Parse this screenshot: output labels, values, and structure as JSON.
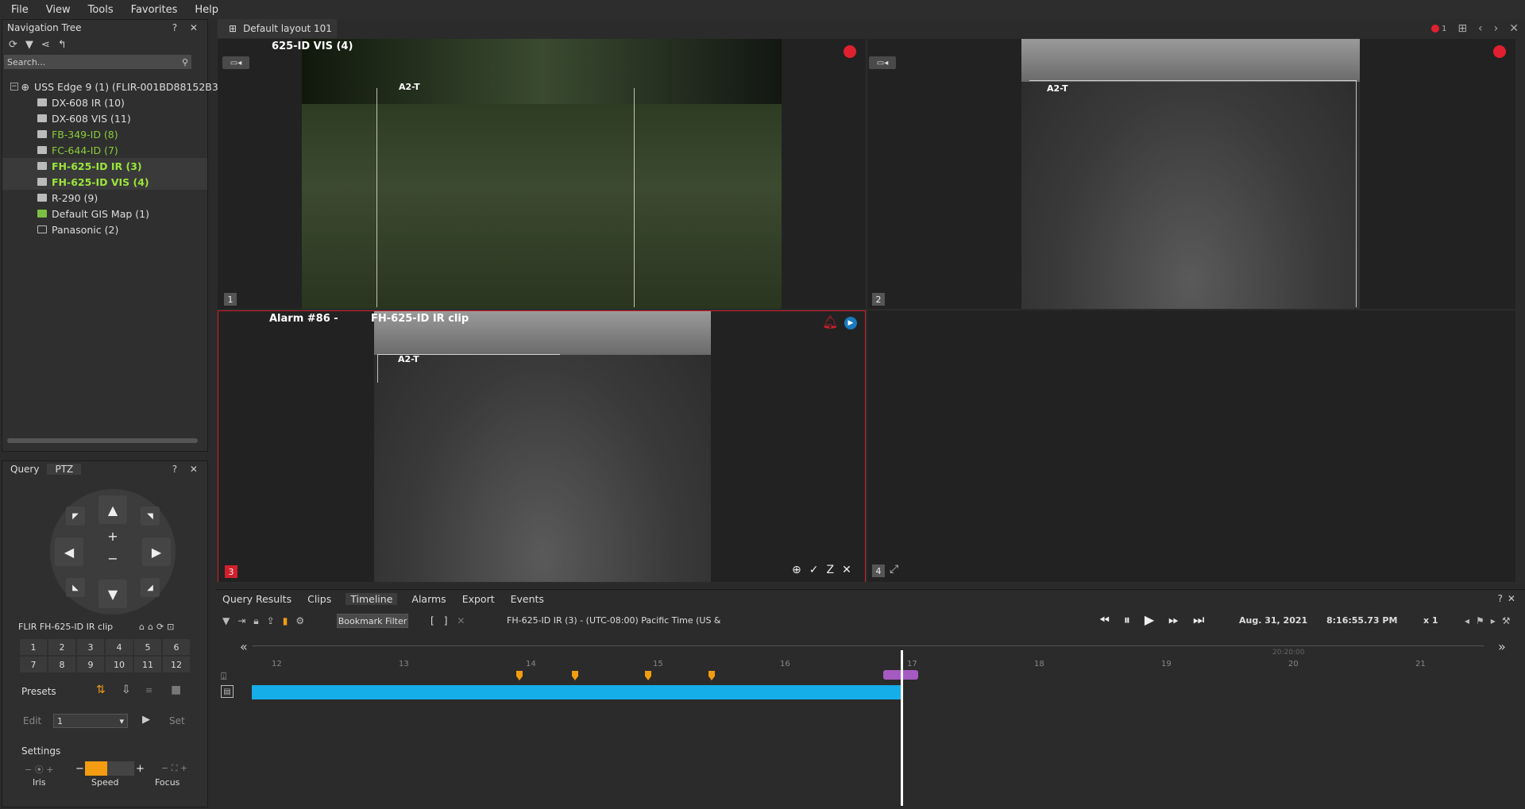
{
  "menu": [
    "File",
    "View",
    "Tools",
    "Favorites",
    "Help"
  ],
  "nav": {
    "title": "Navigation Tree",
    "controls": "? ✕",
    "search_placeholder": "Search...",
    "root": "USS Edge 9 (1) (FLIR-001BD88152B3)",
    "items": [
      {
        "label": "DX-608 IR (10)",
        "style": "normal"
      },
      {
        "label": "DX-608 VIS (11)",
        "style": "normal"
      },
      {
        "label": "FB-349-ID (8)",
        "style": "green"
      },
      {
        "label": "FC-644-ID (7)",
        "style": "green"
      },
      {
        "label": "FH-625-ID IR (3)",
        "style": "bold-green"
      },
      {
        "label": "FH-625-ID VIS (4)",
        "style": "bold-green"
      },
      {
        "label": "R-290 (9)",
        "style": "normal"
      },
      {
        "label": "Default GIS Map (1)",
        "style": "normal"
      },
      {
        "label": "Panasonic (2)",
        "style": "normal"
      }
    ]
  },
  "ptz": {
    "tabs": [
      "Query",
      "PTZ"
    ],
    "active_tab": "PTZ",
    "controls": "? ✕",
    "camera_name": "FLIR FH-625-ID IR clip",
    "presets_grid": [
      "1",
      "2",
      "3",
      "4",
      "5",
      "6",
      "7",
      "8",
      "9",
      "10",
      "11",
      "12"
    ],
    "presets_label": "Presets",
    "edit_label": "Edit",
    "preset_value": "1",
    "set_label": "Set",
    "settings_label": "Settings",
    "iris_label": "Iris",
    "speed_label": "Speed",
    "focus_label": "Focus",
    "speed_level": 0.45
  },
  "layout_tab": "Default layout 101",
  "alarm_count": "1",
  "tiles": {
    "t1": {
      "label": "625-ID VIS (4)",
      "num": "1",
      "zone": "A2-T"
    },
    "t2": {
      "label": "",
      "num": "2",
      "zone": "A2-T"
    },
    "t3": {
      "label_left": "Alarm #86 -",
      "label_right": "FH-625-ID IR clip",
      "num": "3",
      "zone": "A2-T"
    },
    "t4": {
      "num": "4"
    }
  },
  "bottom": {
    "tabs": [
      "Query Results",
      "Clips",
      "Timeline",
      "Alarms",
      "Export",
      "Events"
    ],
    "active_tab": "Timeline",
    "bookmark_filter": "Bookmark Filter",
    "source": "FH-625-ID IR (3) - (UTC-08:00) Pacific Time (US &",
    "date": "Aug. 31, 2021",
    "time": "8:16:55.73 PM",
    "speed": "x 1",
    "ticks": [
      "12",
      "13",
      "14",
      "15",
      "16",
      "17",
      "18",
      "19",
      "20",
      "21"
    ],
    "tick_far": "20:20:00"
  },
  "colors": {
    "accent": "#15aee8",
    "alarm": "#d0202d",
    "marker": "#f39c12",
    "active_green": "#9be53a"
  }
}
